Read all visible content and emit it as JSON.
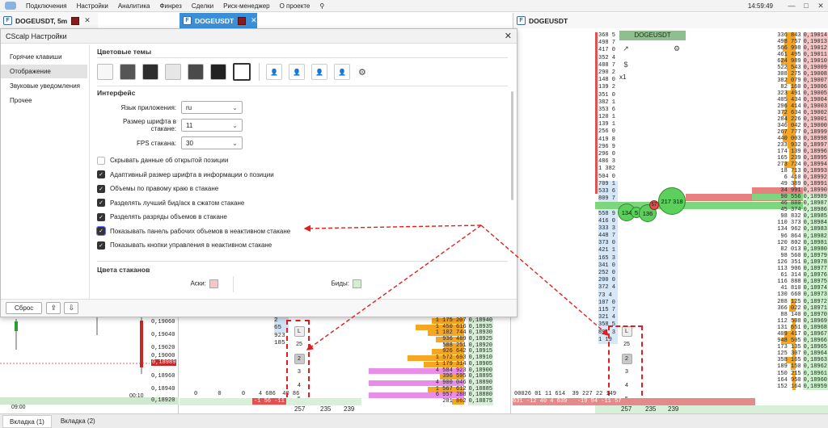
{
  "menubar": {
    "items": [
      "Подключения",
      "Настройки",
      "Аналитика",
      "Финрез",
      "Сделки",
      "Риск-менеджер",
      "О проекте"
    ],
    "clock": "14:59:49"
  },
  "window_tabs": {
    "left": "DOGEUSDT, 5m",
    "mid": "DOGEUSDT",
    "right": "DOGEUSDT"
  },
  "dialog": {
    "title": "CScalp Настройки",
    "nav": [
      "Горячие клавиши",
      "Отображение",
      "Звуковые уведомления",
      "Прочее"
    ],
    "active_nav": "Отображение",
    "themes_title": "Цветовые темы",
    "theme_colors": [
      "#f7f7f7",
      "#555555",
      "#2e2e2e",
      "#e6e6e6",
      "#4a4a4a",
      "#222222",
      "#ffffff"
    ],
    "interface_title": "Интерфейс",
    "language_label": "Язык приложения:",
    "language_value": "ru",
    "font_label": "Размер шрифта в стакане:",
    "font_value": "11",
    "fps_label": "FPS стакана:",
    "fps_value": "30",
    "checkboxes": [
      {
        "label": "Скрывать данные об открытой позиции",
        "checked": false
      },
      {
        "label": "Адаптивный размер шрифта в информации о позиции",
        "checked": true
      },
      {
        "label": "Объемы по правому краю в стакане",
        "checked": true
      },
      {
        "label": "Разделять лучший бид/аск в сжатом стакане",
        "checked": true
      },
      {
        "label": "Разделять разряды объемов в стакане",
        "checked": true
      },
      {
        "label": "Показывать панель рабочих объемов в неактивном стакане",
        "checked": true
      },
      {
        "label": "Показывать кнопки управления в неактивном стакане",
        "checked": true
      }
    ],
    "book_colors_title": "Цвета стаканов",
    "asks_label": "Аски:",
    "bids_label": "Биды:",
    "ask_color": "#f5c6c6",
    "bid_color": "#cdf2cd",
    "reset_label": "Сброс"
  },
  "left_chart": {
    "prices": [
      "0,19060",
      "0,19040",
      "0,19020",
      "0,19000",
      "0,18980",
      "0,18960",
      "0,18940",
      "0,18920"
    ],
    "current_price": "0,18989",
    "time1": "09:00",
    "time2": "00:10",
    "totals": [
      "0",
      "0",
      "0",
      "4 686",
      "40 86"
    ]
  },
  "mid_book": {
    "rows": [
      [
        "1 175 207",
        "0,18940"
      ],
      [
        "1 450 616",
        "0,18935"
      ],
      [
        "1 102 744",
        "0,18930"
      ],
      [
        "936 489",
        "0,18925"
      ],
      [
        "588 251",
        "0,18920"
      ],
      [
        "926 642",
        "0,18915"
      ],
      [
        "1 572 693",
        "0,18910"
      ],
      [
        "1 179 314",
        "0,18905"
      ],
      [
        "4 584 923",
        "0,18900"
      ],
      [
        "396 595",
        "0,18895"
      ],
      [
        "4 900 046",
        "0,18890"
      ],
      [
        "1 567 612",
        "0,18885"
      ],
      [
        "6 957 288",
        "0,18880"
      ],
      [
        "281 862",
        "0,18875"
      ]
    ],
    "scale_buttons": [
      "L",
      "25",
      "2",
      "3",
      "4",
      "5"
    ],
    "footer": [
      "257",
      "235",
      "239"
    ],
    "left_vals": [
      "2 65",
      "923",
      "185"
    ],
    "pnl": "-1 56 -11"
  },
  "right_book": {
    "symbol": "DOGEUSDT",
    "left_volumes": [
      "368 5",
      "498 7",
      "417 0",
      "352 4",
      "488 7",
      "290 2",
      "148 0",
      "139 2",
      "351 0",
      "382 1",
      "353 6",
      "120 1",
      "139 1",
      "256 0",
      "419 8",
      "296 9",
      "296 0",
      "486 3",
      "1 382",
      "504 0",
      "709 1",
      "533 6",
      "809 7",
      "493 4",
      "558 9",
      "416 0",
      "333 3",
      "448 7",
      "373 0",
      "421 1",
      "165 3",
      "341 0",
      "252 0",
      "200 0",
      "372 4",
      "73 4",
      "107 0",
      "115 7",
      "321 4",
      "358 5",
      "891 3",
      "1 19"
    ],
    "asks": [
      [
        "336 843",
        "0,19014"
      ],
      [
        "498 757",
        "0,19013"
      ],
      [
        "566 998",
        "0,19012"
      ],
      [
        "461 495",
        "0,19011"
      ],
      [
        "624 989",
        "0,19010"
      ],
      [
        "522 543",
        "0,19009"
      ],
      [
        "308 275",
        "0,19008"
      ],
      [
        "382 079",
        "0,19007"
      ],
      [
        "82 160",
        "0,19006"
      ],
      [
        "323 491",
        "0,19005"
      ],
      [
        "405 434",
        "0,19004"
      ],
      [
        "296 414",
        "0,19003"
      ],
      [
        "372 634",
        "0,19002"
      ],
      [
        "284 226",
        "0,19001"
      ],
      [
        "346 042",
        "0,19000"
      ],
      [
        "267 777",
        "0,18999"
      ],
      [
        "440 003",
        "0,18998"
      ],
      [
        "233 932",
        "0,18997"
      ],
      [
        "174 139",
        "0,18996"
      ],
      [
        "165 239",
        "0,18995"
      ],
      [
        "273 724",
        "0,18994"
      ],
      [
        "18 713",
        "0,18993"
      ],
      [
        "6 410",
        "0,18992"
      ],
      [
        "49 389",
        "0,18991"
      ],
      [
        "34 991",
        "0,18990"
      ]
    ],
    "bids": [
      [
        "90 556",
        "0,18989"
      ],
      [
        "46 880",
        "0,18987"
      ],
      [
        "45 374",
        "0,18986"
      ],
      [
        "98 832",
        "0,18985"
      ],
      [
        "110 373",
        "0,18984"
      ],
      [
        "134 962",
        "0,18983"
      ],
      [
        "96 864",
        "0,18982"
      ],
      [
        "120 802",
        "0,18981"
      ],
      [
        "82 013",
        "0,18980"
      ],
      [
        "98 560",
        "0,18979"
      ],
      [
        "126 351",
        "0,18978"
      ],
      [
        "113 906",
        "0,18977"
      ],
      [
        "61 314",
        "0,18976"
      ],
      [
        "116 888",
        "0,18975"
      ],
      [
        "41 810",
        "0,18974"
      ],
      [
        "130 660",
        "0,18973"
      ],
      [
        "288 125",
        "0,18972"
      ],
      [
        "366 022",
        "0,18971"
      ],
      [
        "88 140",
        "0,18970"
      ],
      [
        "112 508",
        "0,18969"
      ],
      [
        "131 651",
        "0,18968"
      ],
      [
        "409 417",
        "0,18967"
      ],
      [
        "948 505",
        "0,18966"
      ],
      [
        "173 135",
        "0,18965"
      ],
      [
        "125 307",
        "0,18964"
      ],
      [
        "358 165",
        "0,18963"
      ],
      [
        "189 150",
        "0,18962"
      ],
      [
        "150 215",
        "0,18961"
      ],
      [
        "164 950",
        "0,18960"
      ],
      [
        "152 164",
        "0,18959"
      ]
    ],
    "bubbles": [
      "217 318",
      "134",
      "5",
      "136",
      "57"
    ],
    "multiplier": "x1",
    "footer": [
      "257",
      "235",
      "239"
    ],
    "bottom_left": [
      "00026",
      "01",
      "11 614",
      "39 227",
      "22 149"
    ],
    "pnl": [
      "631",
      "-12 40",
      "4 639",
      "-19 94",
      "-11 57"
    ]
  },
  "bottom_tabs": [
    "Вкладка (1)",
    "Вкладка (2)"
  ]
}
